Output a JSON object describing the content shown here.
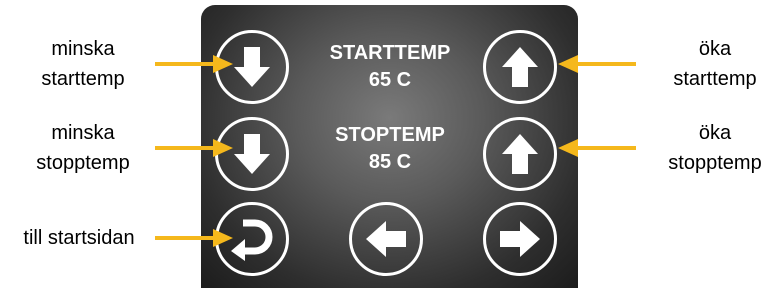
{
  "screen": {
    "start": {
      "title": "STARTTEMP",
      "value": "65 C"
    },
    "stop": {
      "title": "STOPTEMP",
      "value": "85 C"
    }
  },
  "annotations": {
    "minska_start": [
      "minska",
      "starttemp"
    ],
    "minska_stop": [
      "minska",
      "stopptemp"
    ],
    "home": "till startsidan",
    "oka_start": [
      "öka",
      "starttemp"
    ],
    "oka_stop": [
      "öka",
      "stopptemp"
    ]
  },
  "colors": {
    "accent": "#f5b81c",
    "panel": "#555555",
    "button_stroke": "#ffffff"
  },
  "icons": {
    "decrease": "arrow-down-icon",
    "increase": "arrow-up-icon",
    "home": "return-icon",
    "prev": "arrow-left-icon",
    "next": "arrow-right-icon"
  }
}
